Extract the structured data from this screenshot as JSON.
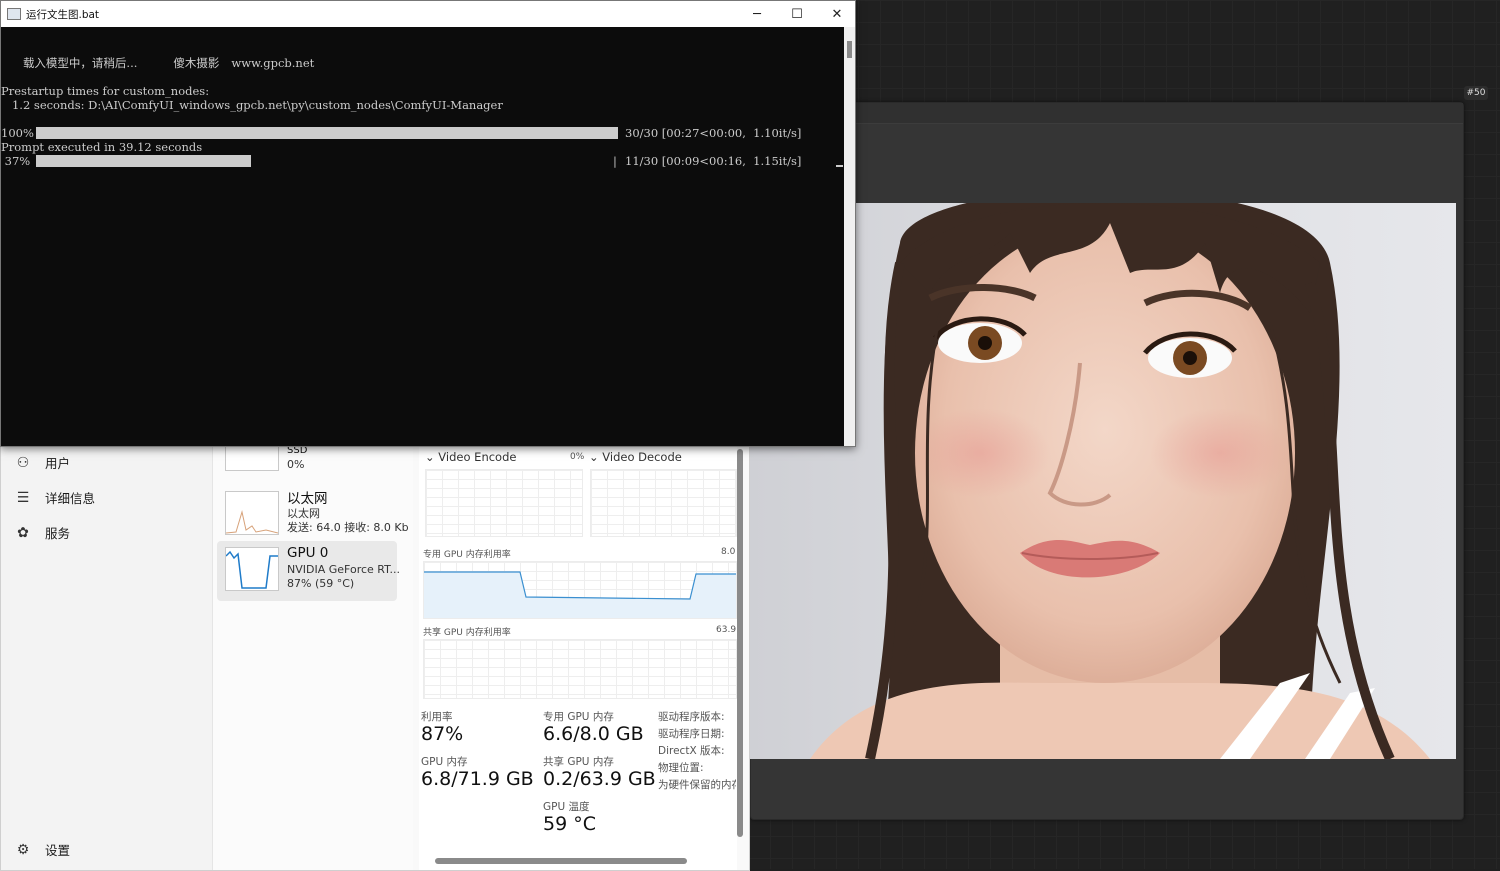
{
  "console": {
    "title": "运行文生图.bat",
    "lines": {
      "loading": "载入模型中，请稍后...",
      "brand": "傻木摄影",
      "site": "www.gpcb.net",
      "prestartup": "Prestartup times for custom_nodes:",
      "node_path": "   1.2 seconds: D:\\AI\\ComfyUI_windows_gpcb.net\\py\\custom_nodes\\ComfyUI-Manager",
      "executed": "Prompt executed in 39.12 seconds"
    },
    "progress_1": {
      "percent_label": "100%",
      "fraction": 1.0,
      "stats": "30/30 [00:27<00:00,  1.10it/s]"
    },
    "progress_2": {
      "percent_label": " 37%",
      "fraction": 0.37,
      "stats": "11/30 [00:09<00:16,  1.15it/s]"
    },
    "window_controls": {
      "minimize": "─",
      "maximize": "☐",
      "close": "✕"
    }
  },
  "node": {
    "badge": "#50"
  },
  "task_manager": {
    "nav": [
      {
        "label": "用户",
        "icon": "users-icon"
      },
      {
        "label": "详细信息",
        "icon": "list-icon"
      },
      {
        "label": "服务",
        "icon": "services-icon"
      }
    ],
    "settings": "设置",
    "resources": {
      "ssd": {
        "title": "SSD",
        "value": "0%"
      },
      "ethernet": {
        "title": "以太网",
        "sub": "以太网",
        "stats": "发送: 64.0 接收: 8.0 Kb"
      },
      "gpu": {
        "title": "GPU 0",
        "sub": "NVIDIA GeForce RT...",
        "stats": "87% (59 °C)"
      }
    },
    "detail": {
      "video_encode": "Video Encode",
      "video_encode_pct": "0%",
      "video_decode": "Video Decode",
      "dedicated_label": "专用 GPU 内存利用率",
      "dedicated_max": "8.0",
      "shared_label": "共享 GPU 内存利用率",
      "shared_max": "63.9",
      "stats": {
        "utilization_label": "利用率",
        "utilization": "87%",
        "dedicated_mem_label": "专用 GPU 内存",
        "dedicated_mem": "6.6/8.0 GB",
        "gpu_mem_label": "GPU 内存",
        "gpu_mem": "6.8/71.9 GB",
        "shared_mem_label": "共享 GPU 内存",
        "shared_mem": "0.2/63.9 GB",
        "temp_label": "GPU 温度",
        "temp": "59 °C"
      },
      "info": {
        "driver_version": "驱动程序版本:",
        "driver_date": "驱动程序日期:",
        "directx": "DirectX 版本:",
        "location": "物理位置:",
        "reserved": "为硬件保留的内存"
      }
    }
  }
}
